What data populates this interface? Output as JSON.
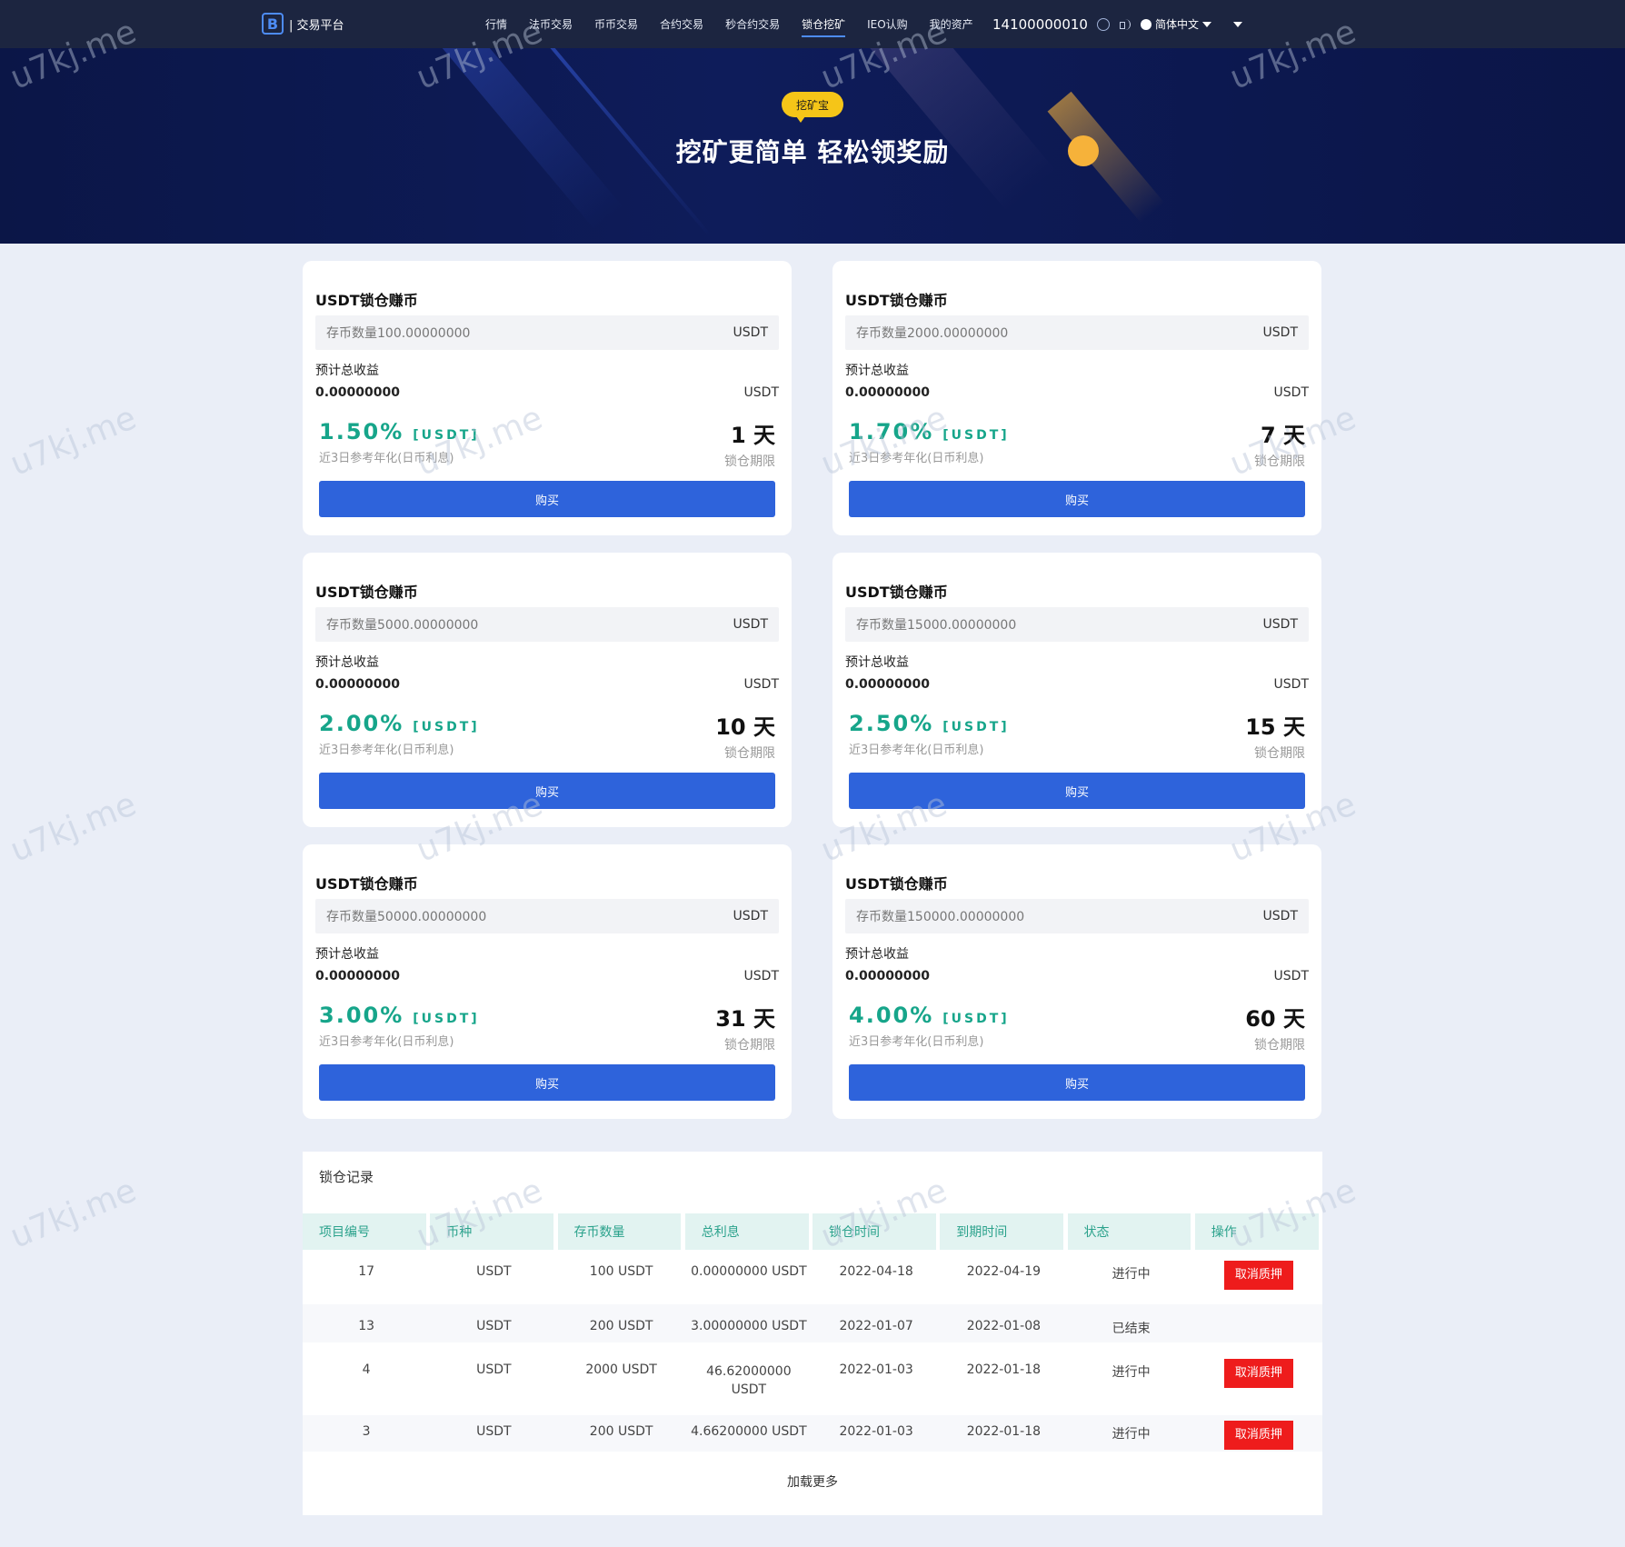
{
  "nav": {
    "logo_text": "| 交易平台",
    "links": [
      "行情",
      "法币交易",
      "币币交易",
      "合约交易",
      "秒合约交易",
      "锁仓挖矿",
      "IEO认购",
      "我的资产"
    ],
    "phone": "14100000010",
    "language": "简体中文"
  },
  "hero": {
    "badge": "挖矿宝",
    "title": "挖矿更简单 轻松领奖励"
  },
  "cards": [
    {
      "title": "USDT锁仓赚币",
      "qty": "存币数量100.00000000",
      "unit": "USDT",
      "est_label": "预计总收益",
      "est_value": "0.00000000",
      "rate": "1.50%",
      "rate_tag": "[USDT]",
      "rate_sub": "近3日参考年化(日币利息)",
      "days": "1 天",
      "days_sub": "锁仓期限",
      "buy": "购买"
    },
    {
      "title": "USDT锁仓赚币",
      "qty": "存币数量2000.00000000",
      "unit": "USDT",
      "est_label": "预计总收益",
      "est_value": "0.00000000",
      "rate": "1.70%",
      "rate_tag": "[USDT]",
      "rate_sub": "近3日参考年化(日币利息)",
      "days": "7 天",
      "days_sub": "锁仓期限",
      "buy": "购买"
    },
    {
      "title": "USDT锁仓赚币",
      "qty": "存币数量5000.00000000",
      "unit": "USDT",
      "est_label": "预计总收益",
      "est_value": "0.00000000",
      "rate": "2.00%",
      "rate_tag": "[USDT]",
      "rate_sub": "近3日参考年化(日币利息)",
      "days": "10 天",
      "days_sub": "锁仓期限",
      "buy": "购买"
    },
    {
      "title": "USDT锁仓赚币",
      "qty": "存币数量15000.00000000",
      "unit": "USDT",
      "est_label": "预计总收益",
      "est_value": "0.00000000",
      "rate": "2.50%",
      "rate_tag": "[USDT]",
      "rate_sub": "近3日参考年化(日币利息)",
      "days": "15 天",
      "days_sub": "锁仓期限",
      "buy": "购买"
    },
    {
      "title": "USDT锁仓赚币",
      "qty": "存币数量50000.00000000",
      "unit": "USDT",
      "est_label": "预计总收益",
      "est_value": "0.00000000",
      "rate": "3.00%",
      "rate_tag": "[USDT]",
      "rate_sub": "近3日参考年化(日币利息)",
      "days": "31 天",
      "days_sub": "锁仓期限",
      "buy": "购买"
    },
    {
      "title": "USDT锁仓赚币",
      "qty": "存币数量150000.00000000",
      "unit": "USDT",
      "est_label": "预计总收益",
      "est_value": "0.00000000",
      "rate": "4.00%",
      "rate_tag": "[USDT]",
      "rate_sub": "近3日参考年化(日币利息)",
      "days": "60 天",
      "days_sub": "锁仓期限",
      "buy": "购买"
    }
  ],
  "records": {
    "title": "锁仓记录",
    "headers": [
      "项目编号",
      "币种",
      "存币数量",
      "总利息",
      "锁仓时间",
      "到期时间",
      "状态",
      "操作"
    ],
    "rows": [
      {
        "id": "17",
        "coin": "USDT",
        "qty": "100 USDT",
        "interest": "0.00000000 USDT",
        "start": "2022-04-18",
        "end": "2022-04-19",
        "status": "进行中",
        "action": "取消质押"
      },
      {
        "id": "13",
        "coin": "USDT",
        "qty": "200 USDT",
        "interest": "3.00000000 USDT",
        "start": "2022-01-07",
        "end": "2022-01-08",
        "status": "已结束",
        "action": ""
      },
      {
        "id": "4",
        "coin": "USDT",
        "qty": "2000 USDT",
        "interest": "46.62000000 USDT",
        "start": "2022-01-03",
        "end": "2022-01-18",
        "status": "进行中",
        "action": "取消质押"
      },
      {
        "id": "3",
        "coin": "USDT",
        "qty": "200 USDT",
        "interest": "4.66200000 USDT",
        "start": "2022-01-03",
        "end": "2022-01-18",
        "status": "进行中",
        "action": "取消质押"
      }
    ],
    "load_more": "加载更多"
  },
  "watermark": "u7kj.me"
}
